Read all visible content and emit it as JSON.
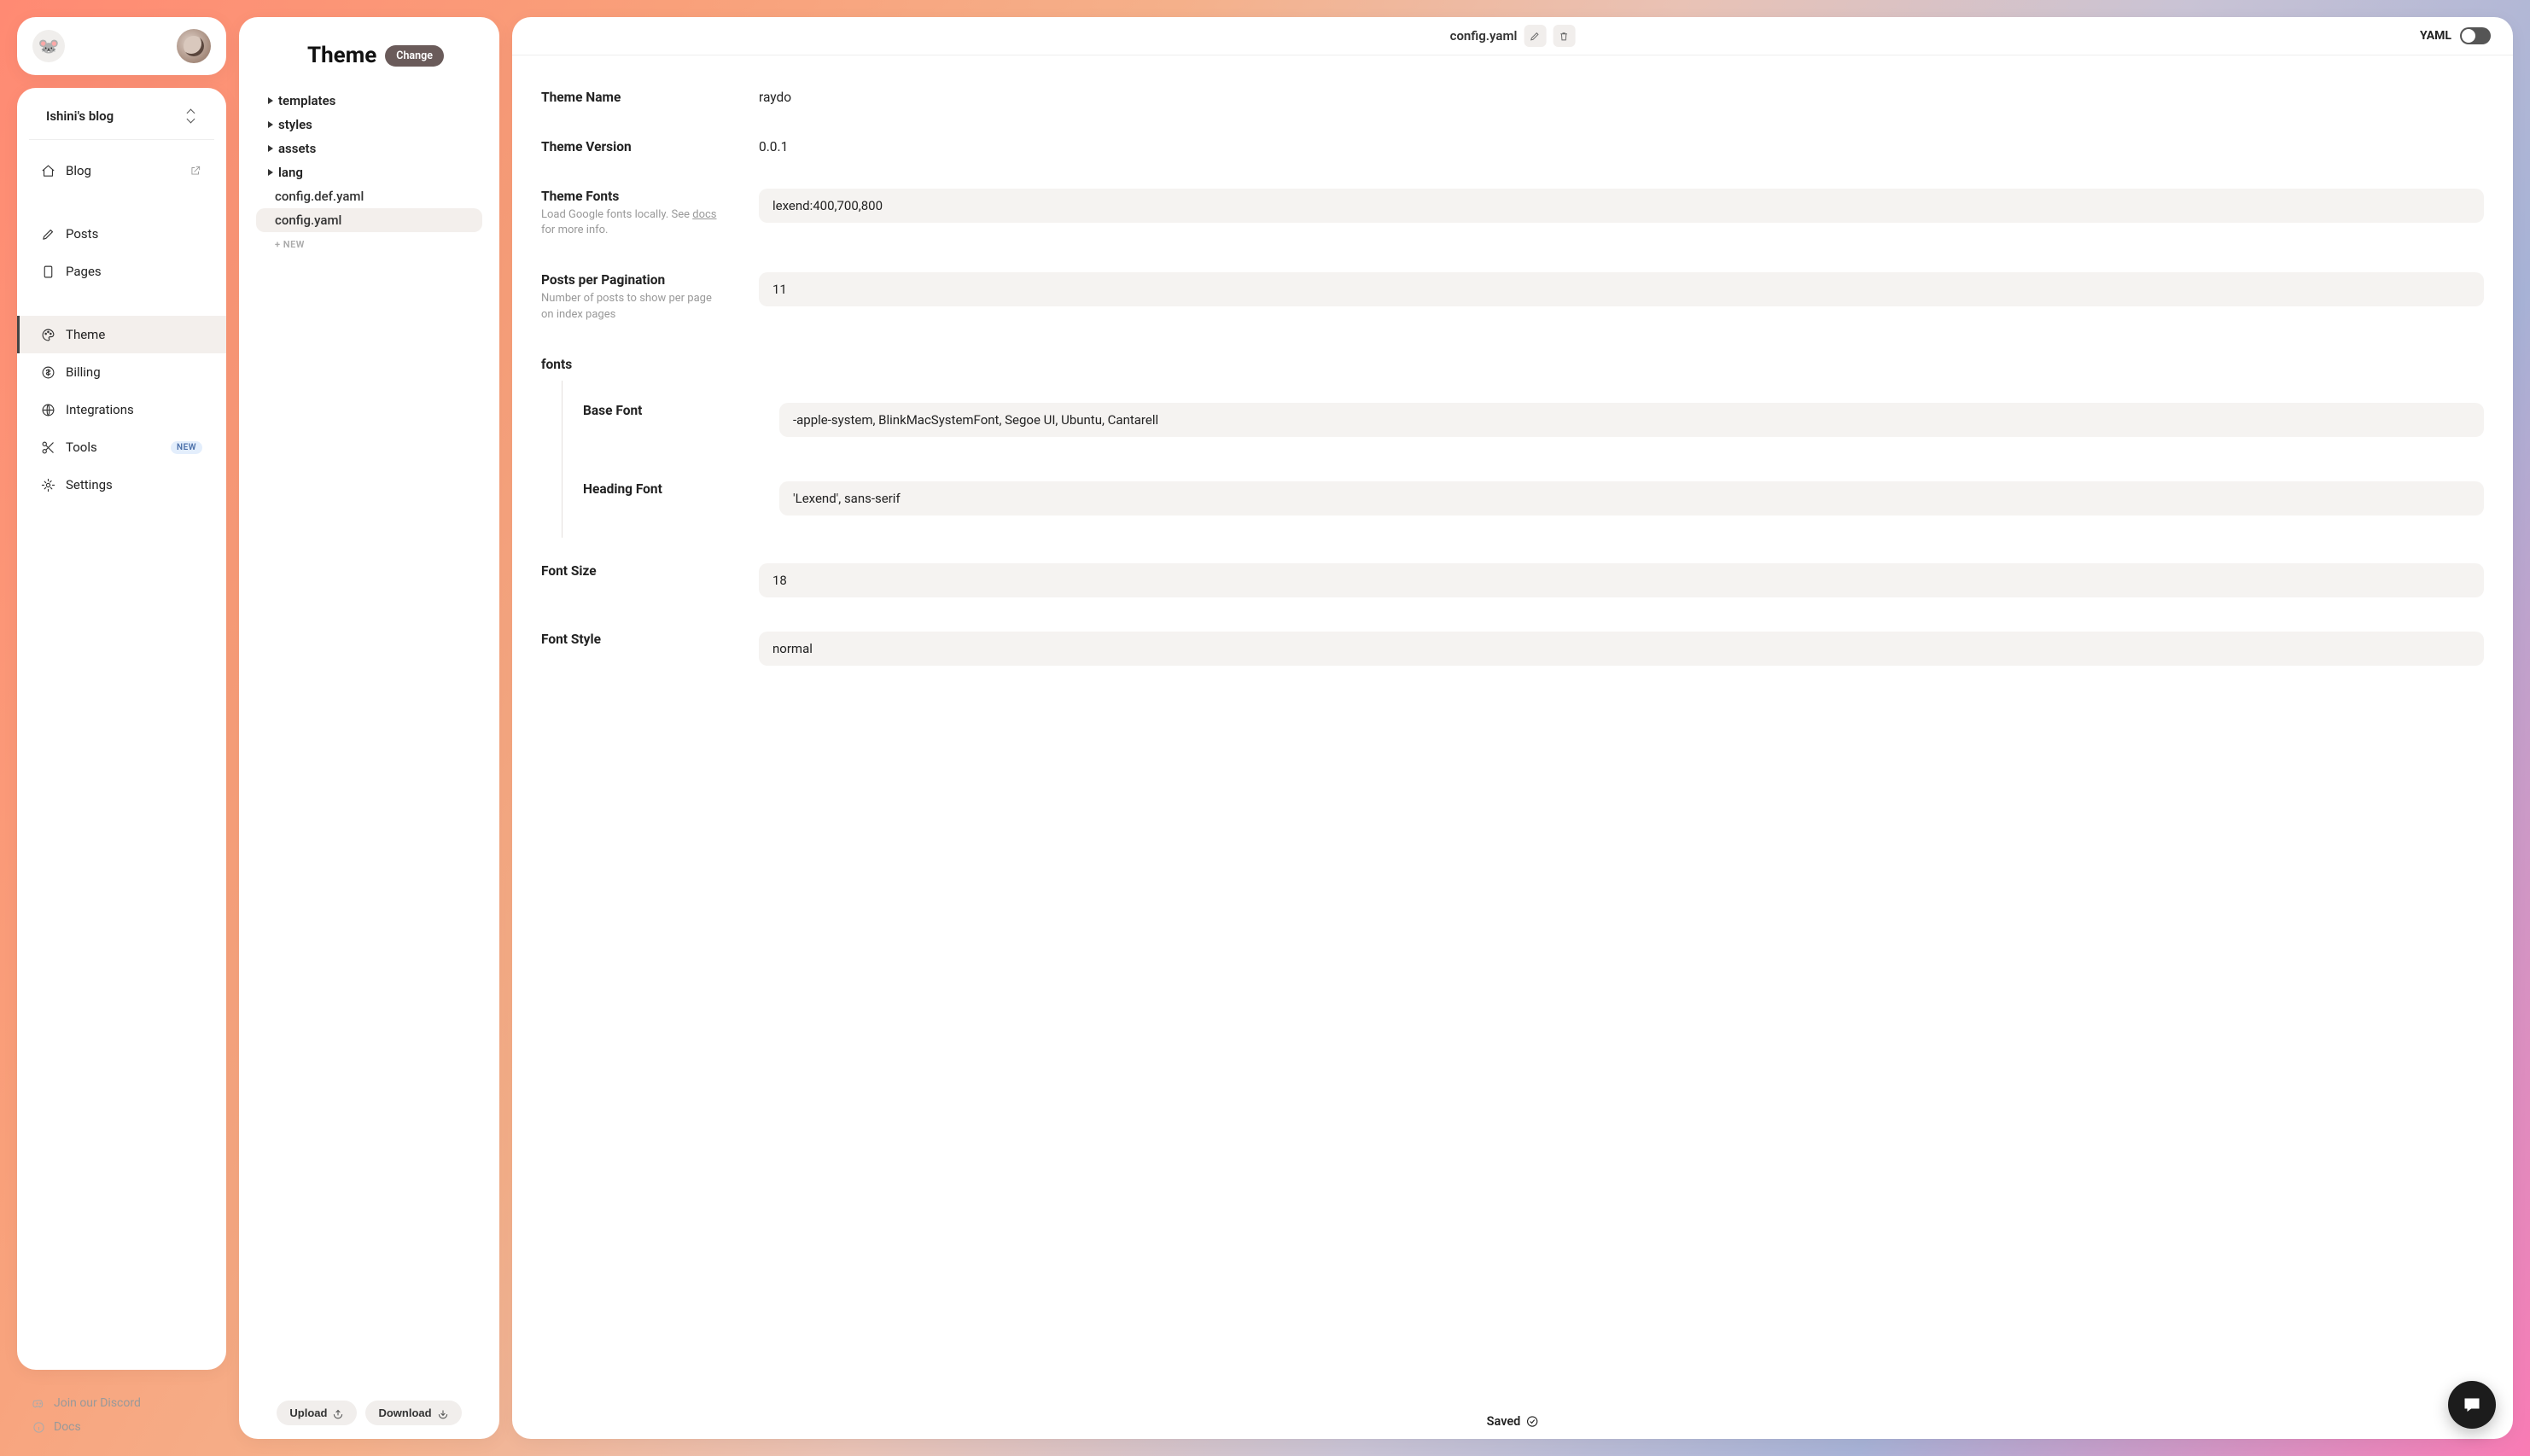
{
  "sidebar": {
    "site_name": "Ishini's blog",
    "nav": {
      "blog": "Blog",
      "posts": "Posts",
      "pages": "Pages",
      "theme": "Theme",
      "billing": "Billing",
      "integrations": "Integrations",
      "tools": "Tools",
      "tools_badge": "NEW",
      "settings": "Settings"
    },
    "footer": {
      "discord": "Join our Discord",
      "docs": "Docs"
    }
  },
  "tree": {
    "title": "Theme",
    "change_label": "Change",
    "folders": [
      "templates",
      "styles",
      "assets",
      "lang"
    ],
    "files": [
      "config.def.yaml",
      "config.yaml"
    ],
    "selected_file": "config.yaml",
    "new_label": "+  NEW",
    "upload_label": "Upload",
    "download_label": "Download"
  },
  "editor": {
    "filename": "config.yaml",
    "mode_label": "YAML",
    "saved_label": "Saved",
    "fields": {
      "theme_name": {
        "label": "Theme Name",
        "value": "raydo"
      },
      "theme_version": {
        "label": "Theme Version",
        "value": "0.0.1"
      },
      "theme_fonts": {
        "label": "Theme Fonts",
        "desc_prefix": "Load Google fonts locally. See ",
        "desc_link": "docs",
        "desc_suffix": " for more info.",
        "value": "lexend:400,700,800"
      },
      "pagination": {
        "label": "Posts per Pagination",
        "desc": "Number of posts to show per page on index pages",
        "value": "11"
      },
      "fonts_section": "fonts",
      "base_font": {
        "label": "Base Font",
        "value": "-apple-system, BlinkMacSystemFont, Segoe UI, Ubuntu, Cantarell"
      },
      "heading_font": {
        "label": "Heading Font",
        "value": "'Lexend', sans-serif"
      },
      "font_size": {
        "label": "Font Size",
        "value": "18"
      },
      "font_style": {
        "label": "Font Style",
        "value": "normal"
      }
    }
  }
}
